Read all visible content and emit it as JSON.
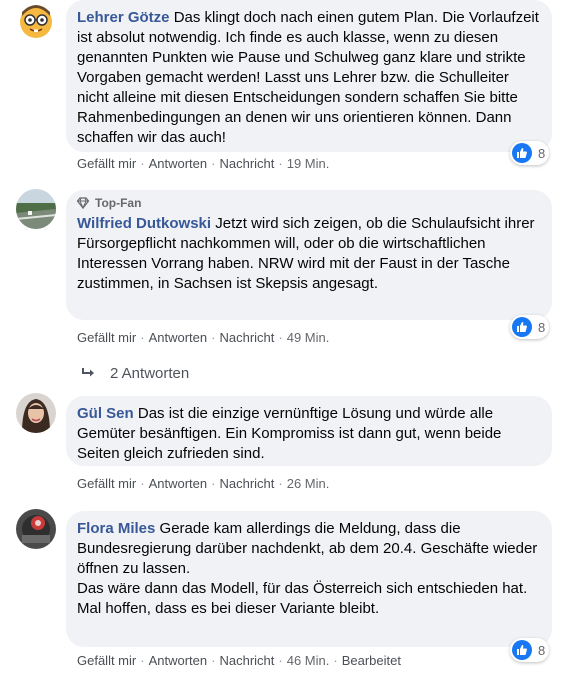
{
  "colors": {
    "bubble_bg": "#f0f2f5",
    "author": "#385898",
    "action": "#65676b",
    "like_blue": "#1877f2"
  },
  "comments": [
    {
      "author": "Lehrer Götze",
      "badge": "",
      "text": "Das klingt doch nach einen gutem Plan. Die Vorlaufzeit ist absolut notwendig. Ich finde es auch klasse, wenn zu diesen genannten Punkten wie Pause und Schulweg ganz klare und strikte Vorgaben gemacht werden! Lasst uns Lehrer bzw. die Schulleiter nicht alleine mit diesen Entscheidungen sondern schaffen Sie bitte Rahmenbedingungen an denen wir uns orientieren können. Dann schaffen wir das auch!",
      "actions": {
        "like": "Gefällt mir",
        "reply": "Antworten",
        "message": "Nachricht",
        "time": "19 Min."
      },
      "reactions": "8",
      "avatar_icon": "nerd-emoji-avatar"
    },
    {
      "author": "Wilfried Dutkowski",
      "badge": "Top-Fan",
      "text": "Jetzt wird sich zeigen, ob die Schulaufsicht ihrer Fürsorgepflicht nachkommen will, oder ob die wirtschaftlichen Interessen Vorrang haben. NRW wird mit der Faust in der Tasche zustimmen, in Sachsen ist Skepsis angesagt.",
      "actions": {
        "like": "Gefällt mir",
        "reply": "Antworten",
        "message": "Nachricht",
        "time": "49 Min."
      },
      "reactions": "8",
      "replies_label": "2 Antworten",
      "avatar_icon": "landscape-avatar"
    },
    {
      "author": "Gül Sen",
      "badge": "",
      "text": "Das ist die einzige vernünftige Lösung und würde alle Gemüter besänftigen. Ein Kompromiss ist dann gut, wenn beide Seiten gleich zufrieden sind.",
      "actions": {
        "like": "Gefällt mir",
        "reply": "Antworten",
        "message": "Nachricht",
        "time": "26 Min."
      },
      "avatar_icon": "portrait-avatar"
    },
    {
      "author": "Flora Miles",
      "badge": "",
      "text_lines": [
        "Gerade kam allerdings die Meldung, dass die Bundesregierung darüber nachdenkt, ab dem 20.4. Geschäfte wieder öffnen zu lassen.",
        "Das wäre dann das Modell, für das Österreich sich entschieden hat.",
        "Mal hoffen, dass es bei dieser Variante bleibt."
      ],
      "actions": {
        "like": "Gefällt mir",
        "reply": "Antworten",
        "message": "Nachricht",
        "time": "46 Min.",
        "edited": "Bearbeitet"
      },
      "reactions": "8",
      "avatar_icon": "dark-object-avatar"
    }
  ]
}
